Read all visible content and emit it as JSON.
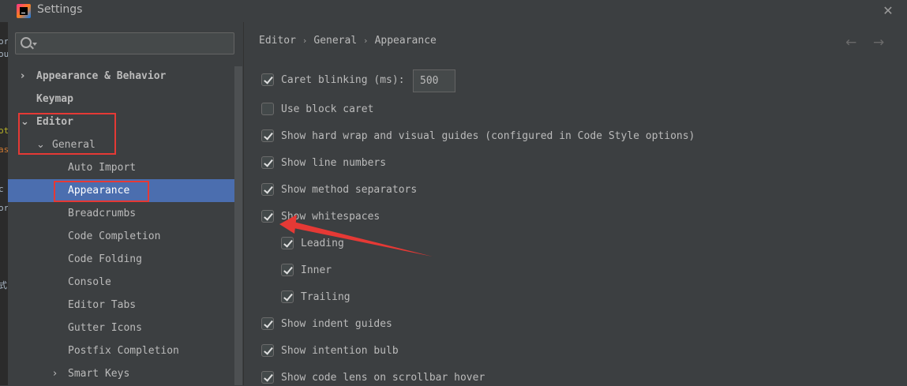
{
  "window": {
    "title": "Settings"
  },
  "behind": {
    "fragments": [
      "ra",
      "or",
      "ou",
      "ot",
      "as",
      "c",
      "or",
      "式"
    ]
  },
  "sidebar": {
    "search": {
      "placeholder": ""
    },
    "items": [
      {
        "label": "Appearance & Behavior",
        "expand": "collapsed"
      },
      {
        "label": "Keymap"
      },
      {
        "label": "Editor",
        "expand": "expanded"
      },
      {
        "label": "General",
        "expand": "expanded"
      },
      {
        "label": "Auto Import"
      },
      {
        "label": "Appearance",
        "selected": true
      },
      {
        "label": "Breadcrumbs"
      },
      {
        "label": "Code Completion"
      },
      {
        "label": "Code Folding"
      },
      {
        "label": "Console"
      },
      {
        "label": "Editor Tabs"
      },
      {
        "label": "Gutter Icons"
      },
      {
        "label": "Postfix Completion"
      },
      {
        "label": "Smart Keys",
        "expand": "collapsed"
      }
    ]
  },
  "breadcrumb": {
    "items": [
      "Editor",
      "General",
      "Appearance"
    ],
    "separator": "›"
  },
  "nav": {
    "back": "←",
    "forward": "→"
  },
  "options": {
    "caret_blinking": {
      "label": "Caret blinking (ms):",
      "checked": true,
      "value": "500"
    },
    "use_block_caret": {
      "label": "Use block caret",
      "checked": false
    },
    "hard_wrap": {
      "label": "Show hard wrap and visual guides (configured in Code Style options)",
      "checked": true
    },
    "line_numbers": {
      "label": "Show line numbers",
      "checked": true
    },
    "method_separators": {
      "label": "Show method separators",
      "checked": true
    },
    "whitespaces": {
      "label": "Show whitespaces",
      "checked": true
    },
    "leading": {
      "label": "Leading",
      "checked": true
    },
    "inner": {
      "label": "Inner",
      "checked": true
    },
    "trailing": {
      "label": "Trailing",
      "checked": true
    },
    "indent_guides": {
      "label": "Show indent guides",
      "checked": true
    },
    "intention_bulb": {
      "label": "Show intention bulb",
      "checked": true
    },
    "code_lens": {
      "label": "Show code lens on scrollbar hover",
      "checked": true
    }
  },
  "colors": {
    "selection": "#4b6eaf",
    "annotation": "#e53935",
    "background": "#3c3f41"
  }
}
